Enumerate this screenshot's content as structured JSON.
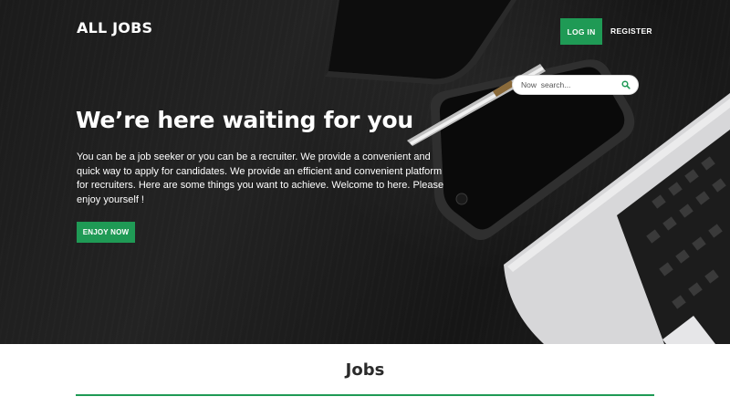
{
  "nav": {
    "brand": "ALL JOBS",
    "login_label": "LOG IN",
    "register_label": "REGISTER"
  },
  "search": {
    "placeholder": "Now  search...",
    "icon": "search-icon"
  },
  "hero": {
    "headline": "We’re here waiting for you",
    "intro": "You can be a job seeker or you can be a recruiter. We provide a convenient and quick way to apply for candidates. We provide an efficient and convenient platform for recruiters. Here are some things you want to achieve. Welcome to here. Please enjoy yourself !",
    "cta_label": "ENJOY NOW"
  },
  "jobs": {
    "title": "Jobs"
  },
  "colors": {
    "accent": "#1f9a55",
    "hero_background": "#1c1c1c",
    "text_on_dark": "#ffffff",
    "section_title": "#2a2a2a"
  }
}
